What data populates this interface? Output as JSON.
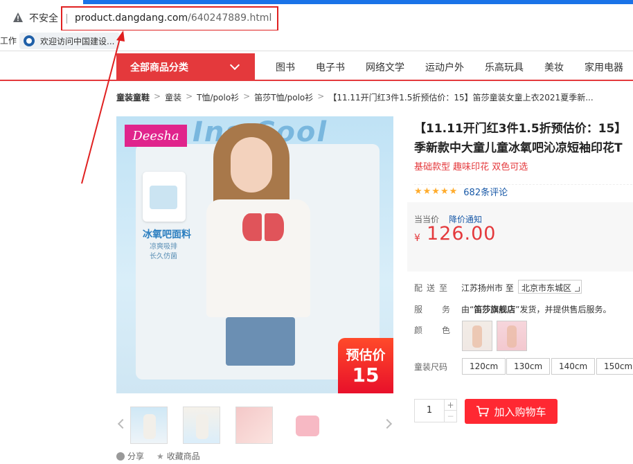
{
  "browser": {
    "security_label": "不安全",
    "url_host": "product.dangdang.com",
    "url_path": "/640247889.html",
    "bookmarks_left": "工作",
    "bookmark_item": "欢迎访问中国建设..."
  },
  "nav": {
    "all_categories": "全部商品分类",
    "links": [
      "图书",
      "电子书",
      "网络文学",
      "运动户外",
      "乐高玩具",
      "美妆",
      "家用电器"
    ]
  },
  "breadcrumb": [
    "童装童鞋",
    "童装",
    "T恤/polo衫",
    "笛莎T恤/polo衫",
    "【11.11开门红3件1.5折预估价：15】笛莎童装女童上衣2021夏季新..."
  ],
  "image": {
    "brand": "Deesha",
    "banner_text": "Ins Cool",
    "fabric_label": "冰氧吧面料",
    "fabric_sub1": "凉爽吸排",
    "fabric_sub2": "长久仿菌",
    "badge_line1": "预估价",
    "badge_line2": "15"
  },
  "actions": {
    "share": "分享",
    "favorite": "收藏商品"
  },
  "product": {
    "title_line1": "【11.11开门红3件1.5折预估价：15】",
    "title_line2": "季新款中大童儿童冰氧吧沁凉短袖印花T",
    "subtitle": "基础款型 趣味印花 双色可选",
    "stars": "★★★★★",
    "reviews": "682条评论",
    "price_label": "当当价",
    "price_notify": "降价通知",
    "currency": "¥",
    "price": "126.00",
    "ship_label": "配送至",
    "ship_from": "江苏扬州市 至",
    "ship_to": "北京市东城区",
    "service_label": "服务",
    "service_prefix": "由“",
    "service_store": "笛莎旗舰店",
    "service_suffix": "”发货，并提供售后服务。",
    "color_label": "颜色",
    "size_label": "童装尺码",
    "sizes": [
      "120cm",
      "130cm",
      "140cm",
      "150cm"
    ],
    "quantity": "1",
    "plus": "+",
    "minus": "−",
    "add_to_cart": "加入购物车"
  },
  "colors": {
    "accent": "#e4393c",
    "cart": "#ff2832",
    "link": "#1a5aa8",
    "chrome_blue": "#1a73e8"
  }
}
